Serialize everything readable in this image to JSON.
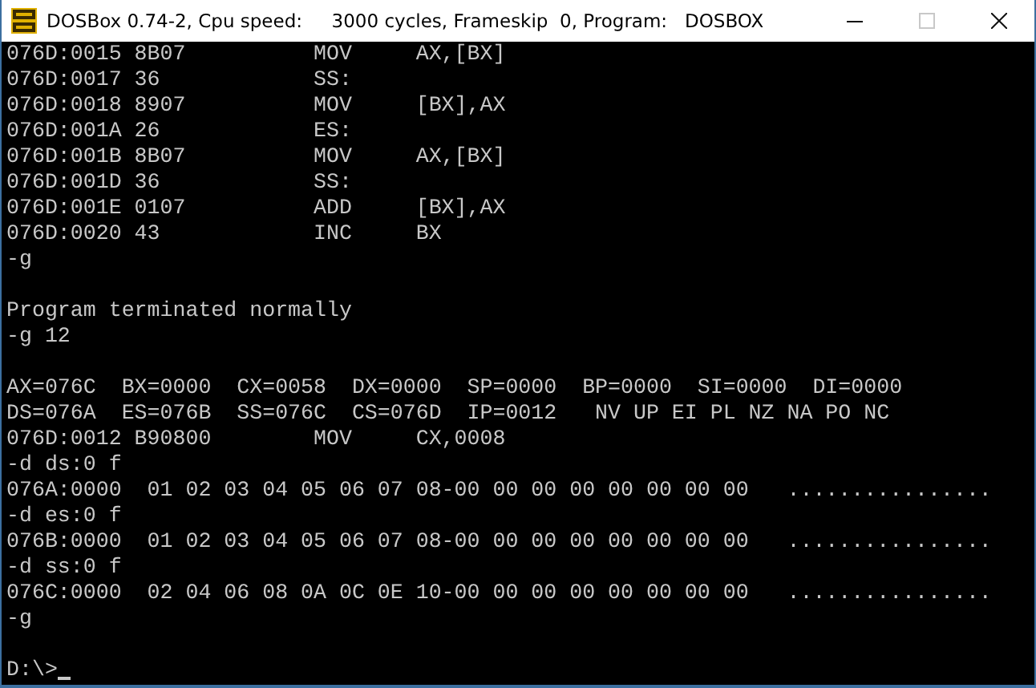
{
  "window": {
    "title": "DOSBox 0.74-2, Cpu speed:     3000 cycles, Frameskip  0, Program:   DOSBOX",
    "controls": [
      {
        "kind": "minimize",
        "disabled": false
      },
      {
        "kind": "maximize",
        "disabled": true
      },
      {
        "kind": "close",
        "disabled": false
      }
    ]
  },
  "console": {
    "lines": [
      {
        "kind": "text",
        "text": "076D:0015 8B07          MOV     AX,[BX]"
      },
      {
        "kind": "text",
        "text": "076D:0017 36            SS:"
      },
      {
        "kind": "text",
        "text": "076D:0018 8907          MOV     [BX],AX"
      },
      {
        "kind": "text",
        "text": "076D:001A 26            ES:"
      },
      {
        "kind": "text",
        "text": "076D:001B 8B07          MOV     AX,[BX]"
      },
      {
        "kind": "text",
        "text": "076D:001D 36            SS:"
      },
      {
        "kind": "text",
        "text": "076D:001E 0107          ADD     [BX],AX"
      },
      {
        "kind": "text",
        "text": "076D:0020 43            INC     BX"
      },
      {
        "kind": "text",
        "text": "-g"
      },
      {
        "kind": "blank"
      },
      {
        "kind": "text",
        "text": "Program terminated normally"
      },
      {
        "kind": "text",
        "text": "-g 12"
      },
      {
        "kind": "blank"
      },
      {
        "kind": "text",
        "text": "AX=076C  BX=0000  CX=0058  DX=0000  SP=0000  BP=0000  SI=0000  DI=0000"
      },
      {
        "kind": "text",
        "text": "DS=076A  ES=076B  SS=076C  CS=076D  IP=0012   NV UP EI PL NZ NA PO NC"
      },
      {
        "kind": "text",
        "text": "076D:0012 B90800        MOV     CX,0008"
      },
      {
        "kind": "text",
        "text": "-d ds:0 f"
      },
      {
        "kind": "text",
        "text": "076A:0000  01 02 03 04 05 06 07 08-00 00 00 00 00 00 00 00   ................"
      },
      {
        "kind": "text",
        "text": "-d es:0 f"
      },
      {
        "kind": "text",
        "text": "076B:0000  01 02 03 04 05 06 07 08-00 00 00 00 00 00 00 00   ................"
      },
      {
        "kind": "text",
        "text": "-d ss:0 f"
      },
      {
        "kind": "text",
        "text": "076C:0000  02 04 06 08 0A 0C 0E 10-00 00 00 00 00 00 00 00   ................"
      },
      {
        "kind": "text",
        "text": "-g"
      },
      {
        "kind": "blank"
      },
      {
        "kind": "prompt",
        "text": "D:\\>",
        "cursor": true
      }
    ]
  }
}
